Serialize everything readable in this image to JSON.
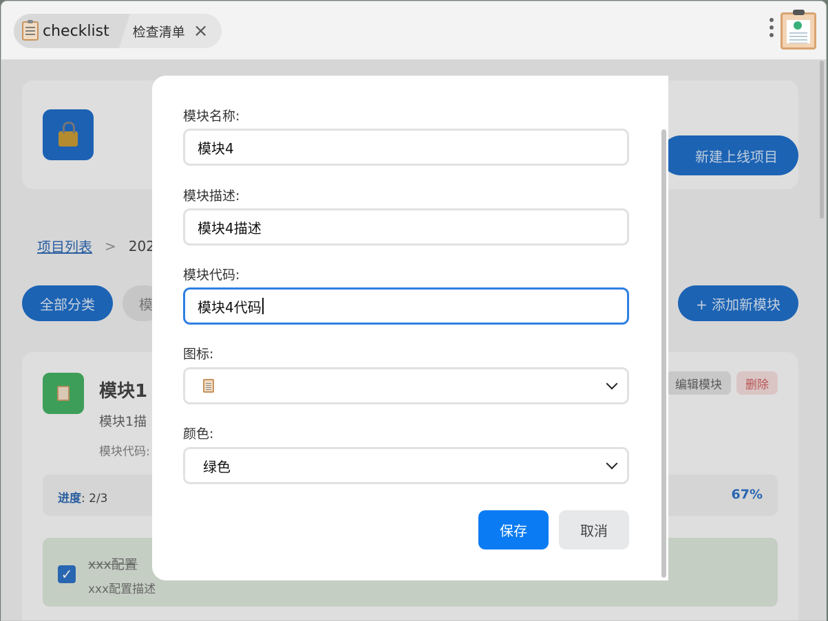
{
  "window": {
    "app_title": "checklist",
    "tab_title": "检查清单"
  },
  "background": {
    "new_project_button": "新建上线项目",
    "breadcrumb": {
      "link": "项目列表",
      "separator": ">",
      "current": "202"
    },
    "filters": {
      "all_label": "全部分类",
      "module_chip": "模"
    },
    "add_module_button": "+ 添加新模块",
    "module_card": {
      "title": "模块1",
      "description": "模块1描",
      "code_label": "模块代码:",
      "edit_button": "编辑模块",
      "delete_button": "删除",
      "progress_label": "进度",
      "progress_value": ": 2/3",
      "progress_percent": "67%",
      "item": {
        "title": "xxx配置",
        "description": "xxx配置描述",
        "checked": true
      }
    }
  },
  "modal": {
    "name_label": "模块名称:",
    "name_value": "模块4",
    "desc_label": "模块描述:",
    "desc_value": "模块4描述",
    "code_label": "模块代码:",
    "code_value": "模块4代码",
    "icon_label": "图标:",
    "icon_value": "clipboard-icon",
    "color_label": "颜色:",
    "color_value": "绿色",
    "save_button": "保存",
    "cancel_button": "取消"
  },
  "colors": {
    "primary": "#0b7bf3",
    "dark_primary": "#0a61c4",
    "module_green": "#33a955",
    "focus_border": "#2e7fe1"
  }
}
